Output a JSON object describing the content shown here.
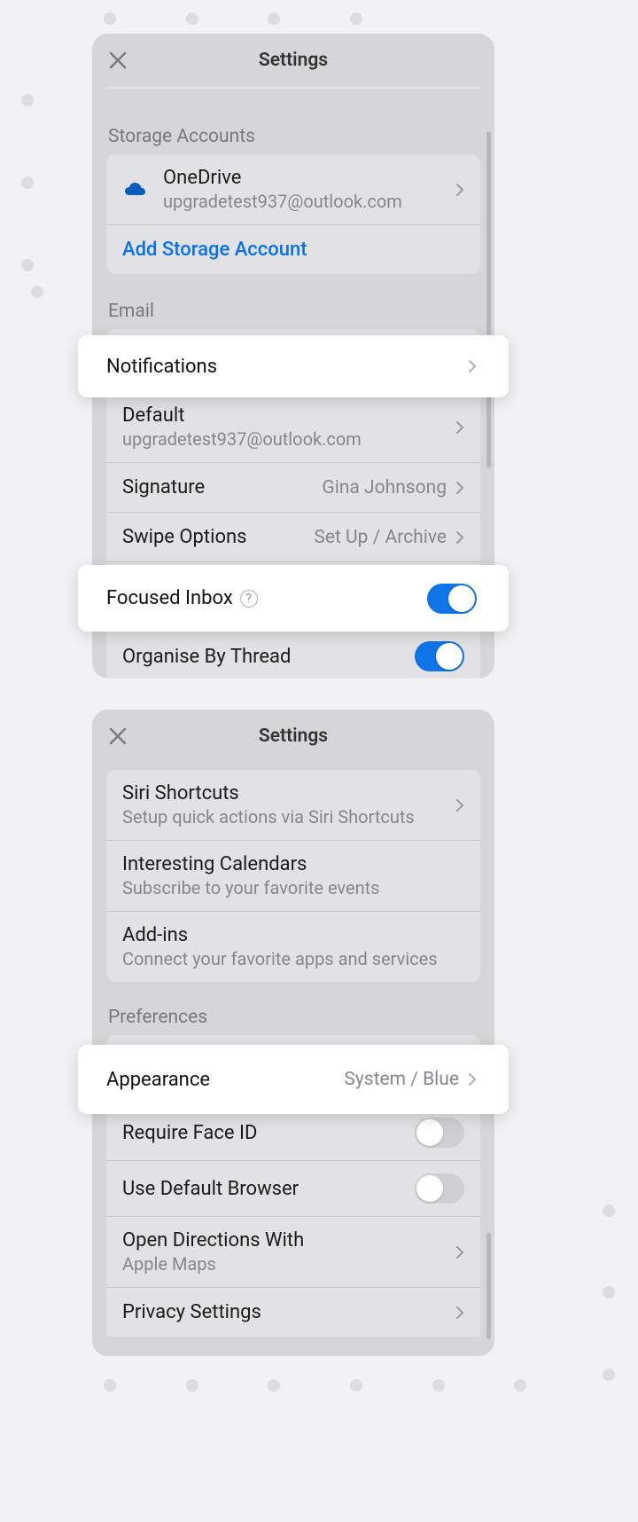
{
  "panel1": {
    "title": "Settings",
    "storage": {
      "header": "Storage Accounts",
      "onedrive_label": "OneDrive",
      "onedrive_email": "upgradetest937@outlook.com",
      "add_label": "Add Storage Account"
    },
    "email": {
      "header": "Email",
      "notifications_label": "Notifications",
      "default_label": "Default",
      "default_value": "upgradetest937@outlook.com",
      "signature_label": "Signature",
      "signature_value": "Gina Johnsong",
      "swipe_label": "Swipe Options",
      "swipe_value": "Set Up / Archive",
      "focused_label": "Focused Inbox",
      "organise_label": "Organise By Thread"
    }
  },
  "panel2": {
    "title": "Settings",
    "siri_title": "Siri Shortcuts",
    "siri_sub": "Setup quick actions via Siri Shortcuts",
    "calendars_title": "Interesting Calendars",
    "calendars_sub": "Subscribe to your favorite events",
    "addins_title": "Add-ins",
    "addins_sub": "Connect your favorite apps and services",
    "prefs_header": "Preferences",
    "appearance_label": "Appearance",
    "appearance_value": "System / Blue",
    "faceid_label": "Require Face ID",
    "browser_label": "Use Default Browser",
    "directions_label": "Open Directions With",
    "directions_value": "Apple Maps",
    "privacy_label": "Privacy Settings"
  }
}
